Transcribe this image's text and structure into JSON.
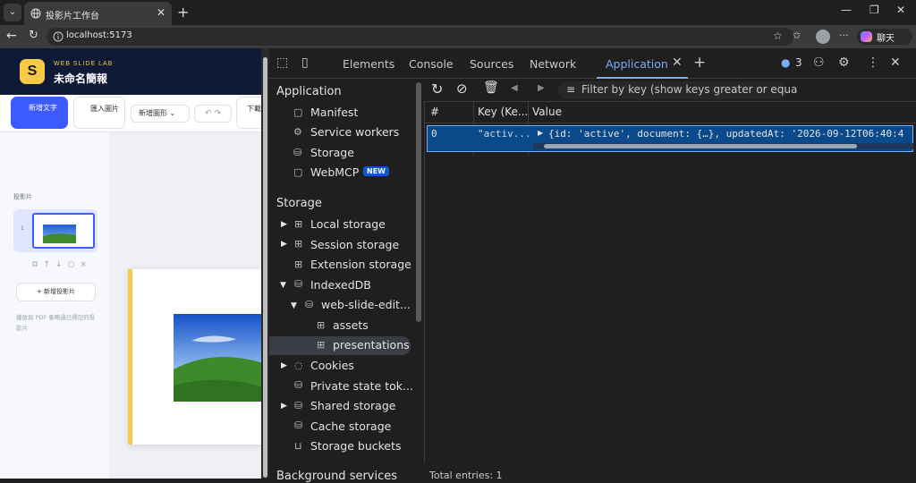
{
  "browser": {
    "tab_title": "投影片工作台",
    "url": "localhost:5173",
    "profile_label": "聊天"
  },
  "app": {
    "brand": "WEB SLIDE LAB",
    "doc_title": "未命名簡報",
    "logo_letter": "S",
    "toolbar": {
      "add_text": "新增文字",
      "import_image": "匯入圖片",
      "add_shape": "新增圖形",
      "download": "下載"
    },
    "sidebar": {
      "heading": "投影片",
      "slide_number": "1",
      "add_slide": "+ 新增投影片",
      "hint": "播放與 PDF 會略過已標記的投影片"
    }
  },
  "devtools": {
    "tabs": [
      "Elements",
      "Console",
      "Sources",
      "Network",
      "Application"
    ],
    "active_tab": "Application",
    "issues_count": "3",
    "sections": {
      "application": {
        "heading": "Application",
        "items": [
          "Manifest",
          "Service workers",
          "Storage",
          "WebMCP"
        ],
        "new_badge": "NEW"
      },
      "storage": {
        "heading": "Storage",
        "items": [
          "Local storage",
          "Session storage",
          "Extension storage",
          "IndexedDB",
          "web-slide-edit...",
          "assets",
          "presentations",
          "Cookies",
          "Private state tok...",
          "Shared storage",
          "Cache storage",
          "Storage buckets"
        ]
      },
      "background": {
        "heading": "Background services"
      }
    },
    "filter_placeholder": "Filter by key (show keys greater or equa",
    "table": {
      "columns": [
        "#",
        "Key (Ke...",
        "Value"
      ],
      "rows": [
        {
          "index": "0",
          "key": "\"activ...",
          "value": "{id: 'active', document: {…}, updatedAt: '2026-09-12T06:40:4"
        }
      ]
    },
    "total_entries": "Total entries: 1"
  },
  "colors": {
    "accent_blue": "#3d5afe",
    "brand_yellow": "#f7c948",
    "devtools_active": "#7cacf8",
    "selected_row": "#0b4a8a"
  }
}
